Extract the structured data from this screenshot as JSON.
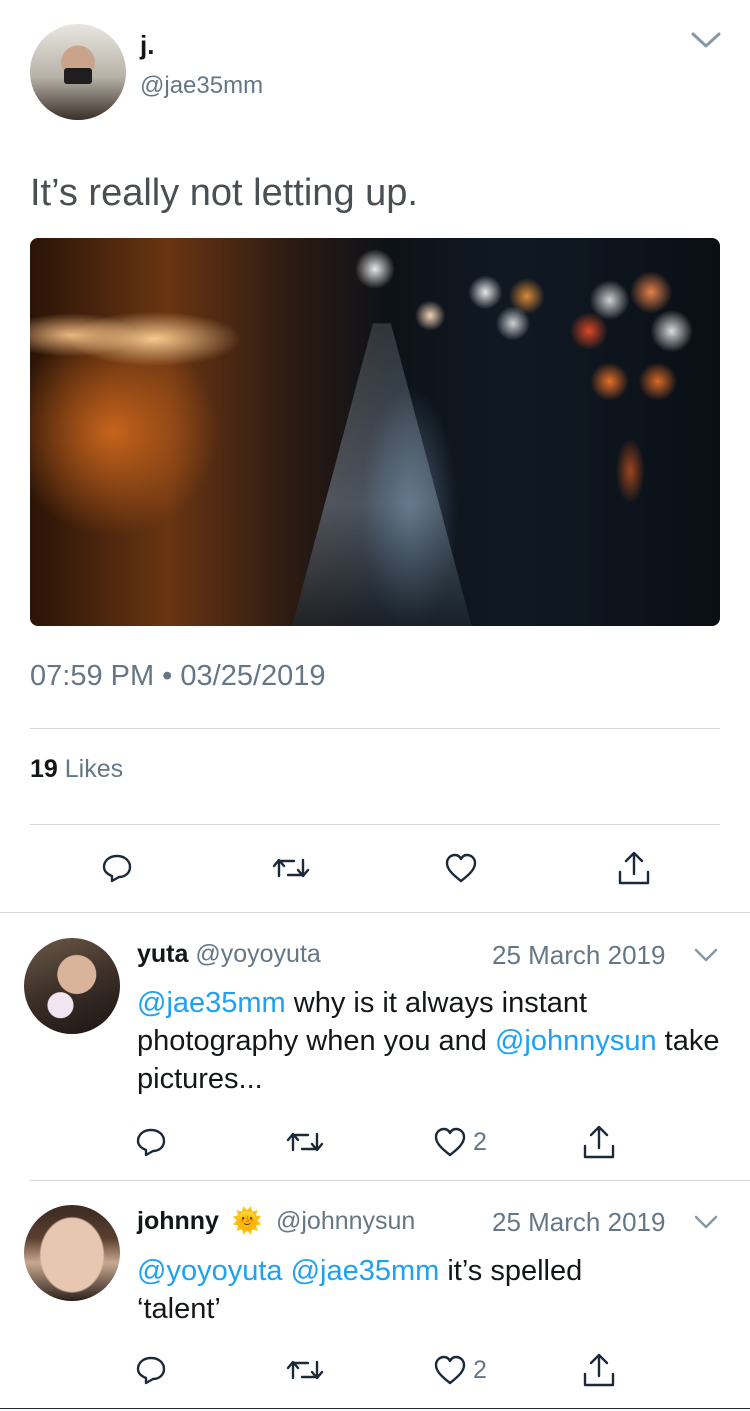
{
  "tweet": {
    "author_name": "j.",
    "handle": "@jae35mm",
    "text": "It’s really not letting up.",
    "timestamp": "07:59 PM • 03/25/2019",
    "likes_count": "19",
    "likes_label": "Likes",
    "avatar_icon": "camera-avatar-icon",
    "menu_icon": "chevron-down-icon"
  },
  "replies": [
    {
      "name": "yuta",
      "handle": "@yoyoyuta",
      "date": "25 March 2019",
      "mention1": "@jae35mm",
      "text1": " why is it always instant photography when you and ",
      "mention2": "@johnnysun",
      "text2": " take pictures...",
      "likes": "2"
    },
    {
      "name": "johnny",
      "emoji": "🌞",
      "handle": "@johnnysun",
      "date": "25 March 2019",
      "mention1": "@yoyoyuta",
      "mention2": " @jae35mm",
      "text1": " it’s spelled ‘talent’",
      "likes": "2"
    }
  ],
  "colors": {
    "link": "#1da1f2",
    "secondary_text": "#657786",
    "divider": "#d6d9db",
    "icon": "#1c2938"
  }
}
